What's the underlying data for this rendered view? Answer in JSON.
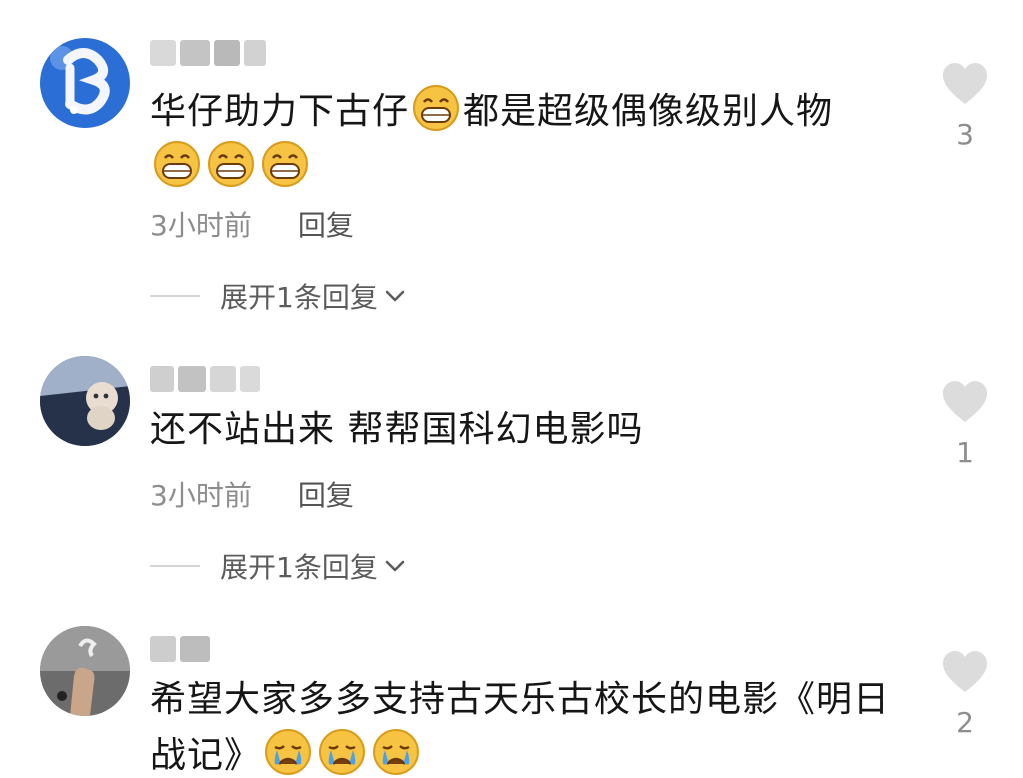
{
  "comments": [
    {
      "text_before": "华仔助力下古仔",
      "text_after": "都是超级偶像级别人物",
      "emoji_inline": "grin-emoji",
      "emoji_trailing": [
        "grin-emoji",
        "grin-emoji",
        "grin-emoji"
      ],
      "time": "3小时前",
      "reply_label": "回复",
      "expand_label": "展开1条回复",
      "like_count": "3"
    },
    {
      "text": "还不站出来 帮帮国科幻电影吗",
      "time": "3小时前",
      "reply_label": "回复",
      "expand_label": "展开1条回复",
      "like_count": "1"
    },
    {
      "text_line1": "希望大家多多支持古天乐古校长的电影《明日",
      "text_line2": "战记》",
      "emoji_trailing": [
        "crying-emoji",
        "crying-emoji",
        "crying-emoji"
      ],
      "like_count": "2"
    }
  ],
  "colors": {
    "text": "#161616",
    "meta": "#8d8d8d",
    "heart": "#dcdcdc",
    "emoji_yellow": "#f6c342",
    "tear_blue": "#4aa3e8"
  }
}
